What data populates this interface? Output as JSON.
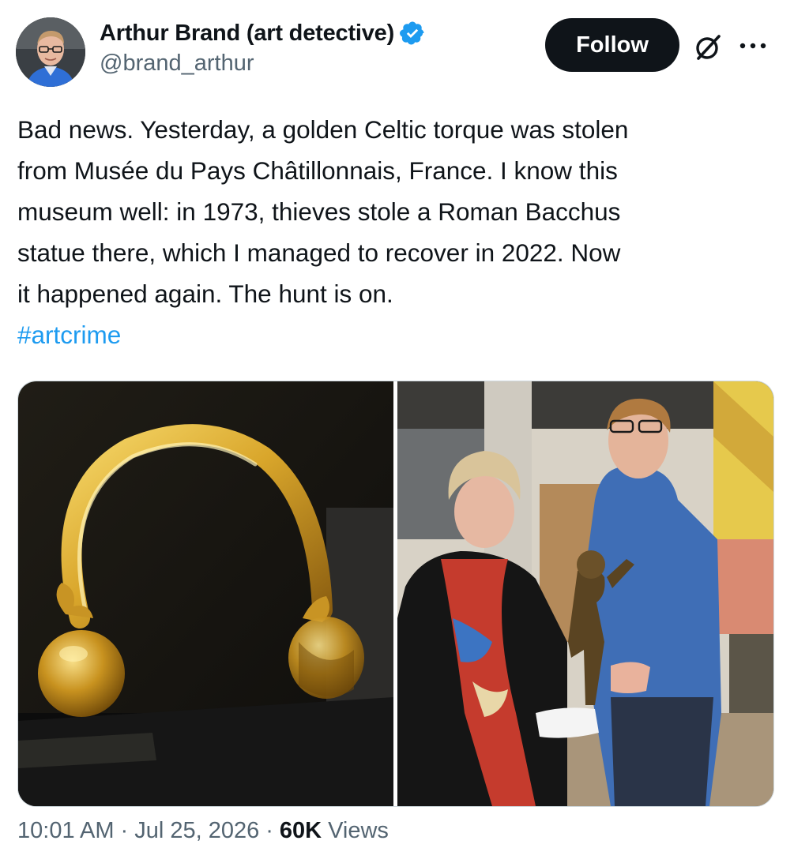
{
  "author": {
    "display_name": "Arthur Brand (art detective)",
    "handle": "@brand_arthur",
    "verified": true,
    "verified_color": "#1d9bf0"
  },
  "actions": {
    "follow_label": "Follow"
  },
  "tweet": {
    "text_lines": [
      "Bad news. Yesterday, a golden Celtic torque was stolen",
      "from Musée du Pays Châtillonnais, France. I know this",
      "museum well: in 1973, thieves stole a Roman Bacchus",
      "statue there, which I managed to recover in 2022. Now",
      "it happened again. The hunt is on."
    ],
    "hashtag": "#artcrime",
    "hashtag_color": "#1d9bf0"
  },
  "media": {
    "photos": [
      {
        "subject": "golden Celtic torque on display"
      },
      {
        "subject": "two people holding a bronze Bacchus statue"
      }
    ]
  },
  "meta": {
    "time": "10:01 AM",
    "separator": "·",
    "date": "Jul 25, 2026",
    "views_count": "60K",
    "views_label": "Views"
  },
  "icons": {
    "verified": "verified-badge-icon",
    "grok": "grok-icon",
    "more": "more-options-icon"
  }
}
